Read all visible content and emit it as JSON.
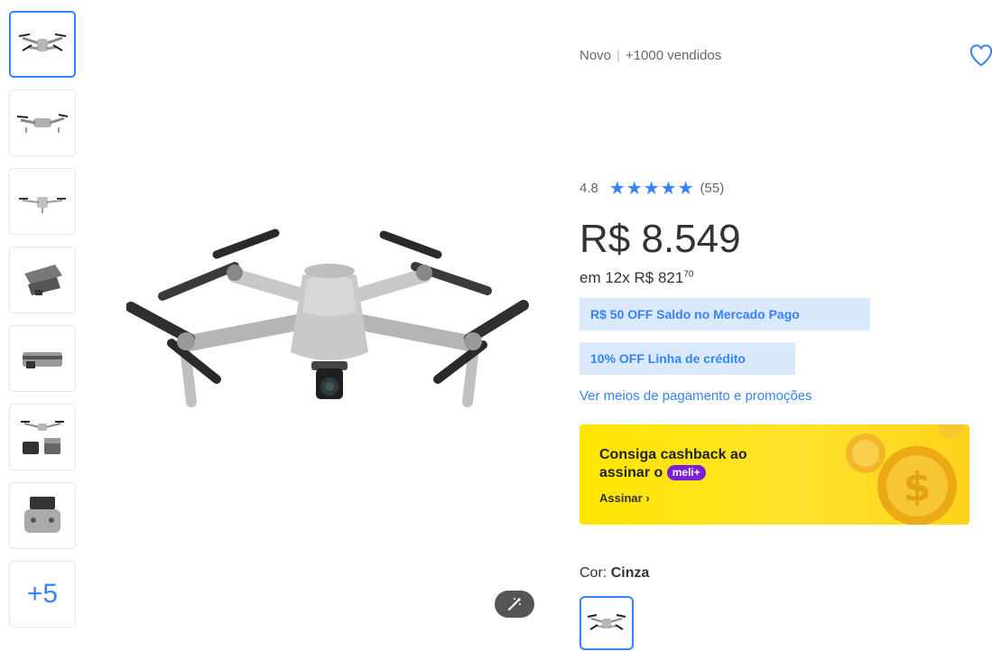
{
  "thumbnails": {
    "items": [
      "drone-front",
      "drone-side",
      "drone-top",
      "drone-folded",
      "drone-folded-side",
      "drone-kit",
      "remote-controller"
    ],
    "more_label": "+5"
  },
  "product": {
    "condition": "Novo",
    "separator": "|",
    "sold": "+1000 vendidos",
    "rating_value": "4.8",
    "stars": "★★★★★",
    "review_count": "(55)",
    "price": "R$ 8.549",
    "installments_prefix": "em 12x",
    "installment_amount": "R$ 821",
    "installment_cents": "70"
  },
  "promotions": {
    "tag1": "R$ 50 OFF Saldo no Mercado Pago",
    "tag2": "10% OFF Linha de crédito",
    "payment_link": "Ver meios de pagamento e promoções"
  },
  "cashback": {
    "line1": "Consiga cashback ao",
    "line2": "assinar o",
    "badge": "meli+",
    "link": "Assinar"
  },
  "variant": {
    "label": "Cor:",
    "value": "Cinza"
  },
  "colors": {
    "accent": "#3483fa",
    "promo_bg": "#dbe9fd",
    "banner_yellow": "#ffe600",
    "meli_purple": "#7a1fd6"
  }
}
